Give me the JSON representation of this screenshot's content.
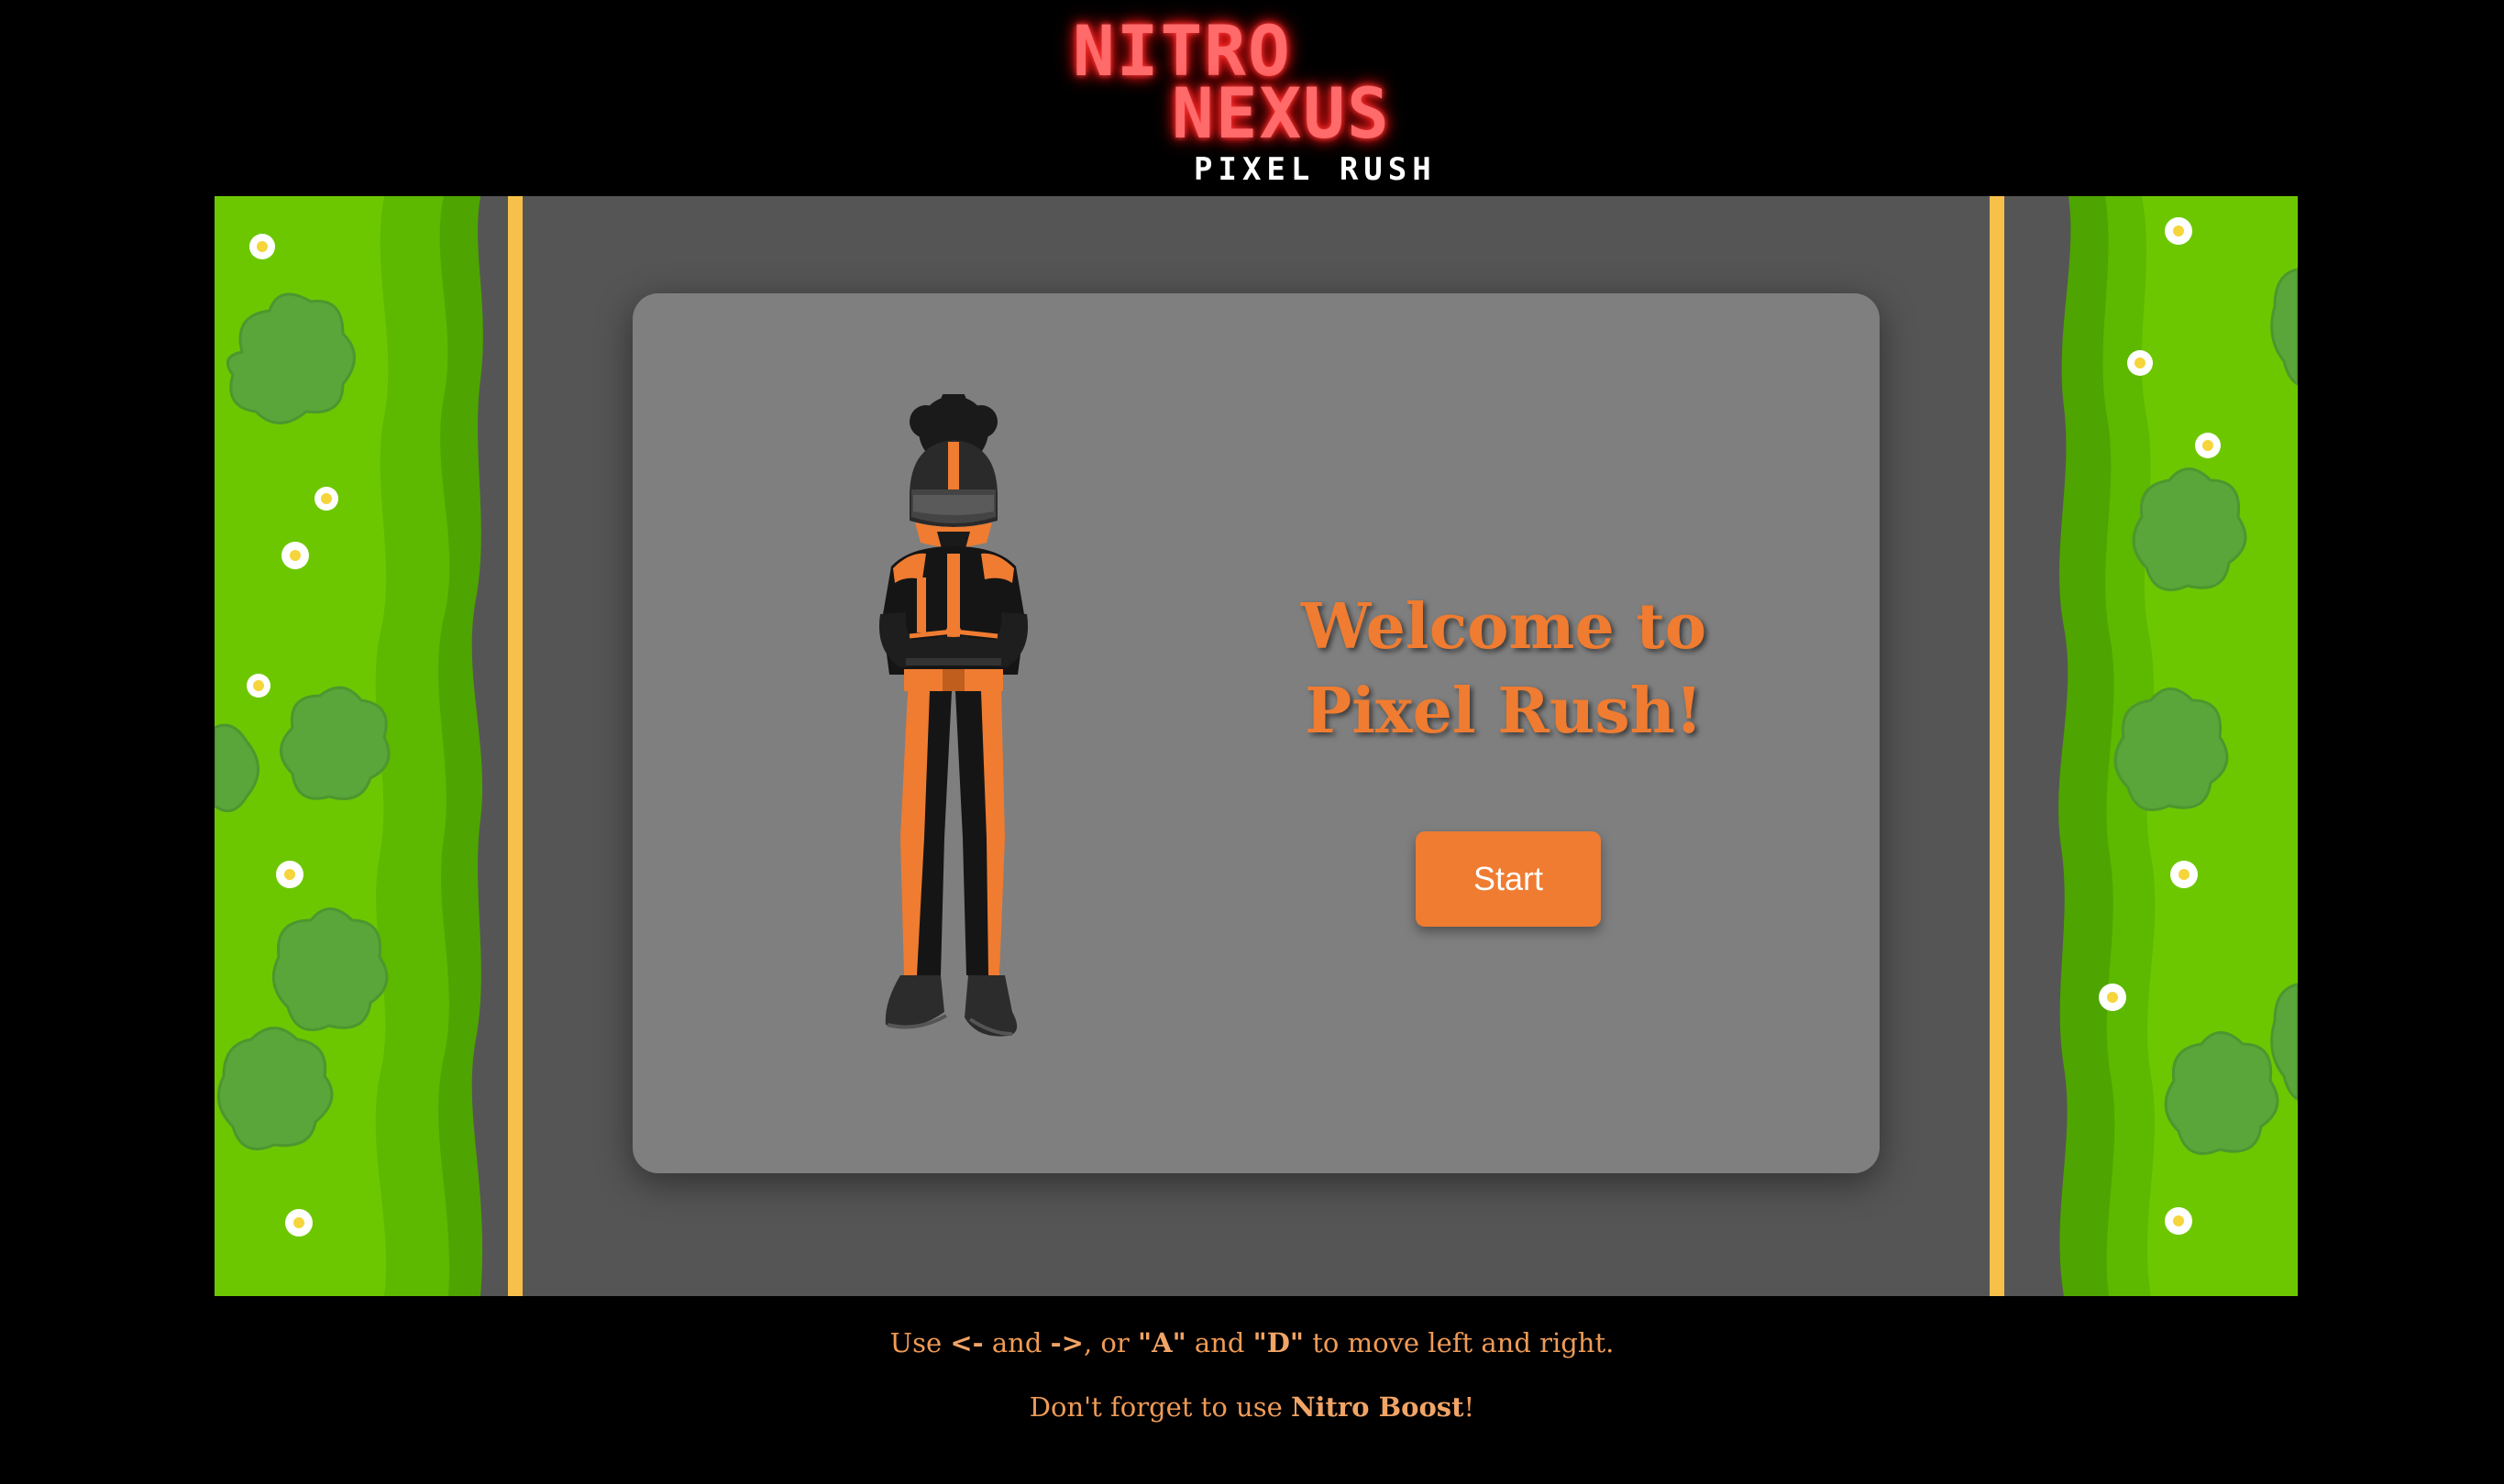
{
  "logo": {
    "line1": "NITRO",
    "line2": "NEXUS",
    "subtitle": "PIXEL RUSH"
  },
  "card": {
    "welcome_line1": "Welcome to",
    "welcome_line2": "Pixel Rush!",
    "start_label": "Start"
  },
  "instructions": {
    "line1": {
      "t1": "Use ",
      "k1": "<-",
      "t2": " and ",
      "k2": "->",
      "t3": ", or ",
      "k3": "\"A\"",
      "t4": " and ",
      "k4": "\"D\"",
      "t5": " to move left and right."
    },
    "line2": {
      "t1": "Don't forget to use ",
      "k1": "Nitro Boost",
      "t2": "!"
    }
  },
  "colors": {
    "accent": "#ef7c31",
    "road": "#555555",
    "card": "#7f7f7f",
    "grass": "#6dc700",
    "lane_line": "#f6c04a",
    "logo_neon": "#ff3b3b"
  }
}
